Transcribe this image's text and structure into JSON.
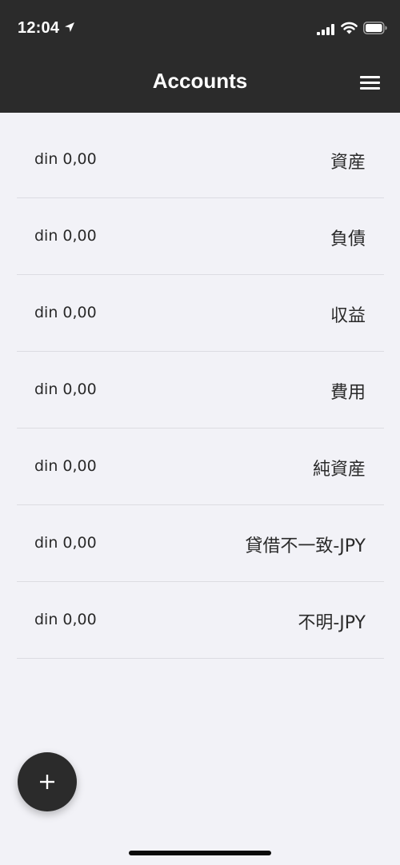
{
  "status_bar": {
    "time": "12:04",
    "icons": [
      "location-arrow-icon",
      "cellular-signal-icon",
      "wifi-icon",
      "battery-icon"
    ]
  },
  "nav": {
    "title": "Accounts",
    "menu_icon": "hamburger-menu-icon"
  },
  "accounts": [
    {
      "balance": "din 0,00",
      "name": "資産"
    },
    {
      "balance": "din 0,00",
      "name": "負債"
    },
    {
      "balance": "din 0,00",
      "name": "収益"
    },
    {
      "balance": "din 0,00",
      "name": "費用"
    },
    {
      "balance": "din 0,00",
      "name": "純資産"
    },
    {
      "balance": "din 0,00",
      "name": "貸借不一致-JPY"
    },
    {
      "balance": "din 0,00",
      "name": "不明-JPY"
    }
  ],
  "fab": {
    "icon": "plus-icon"
  },
  "colors": {
    "header_bg": "#2b2b2b",
    "page_bg": "#f2f2f7",
    "text": "#2a2a2a",
    "divider": "#dcdce2"
  }
}
